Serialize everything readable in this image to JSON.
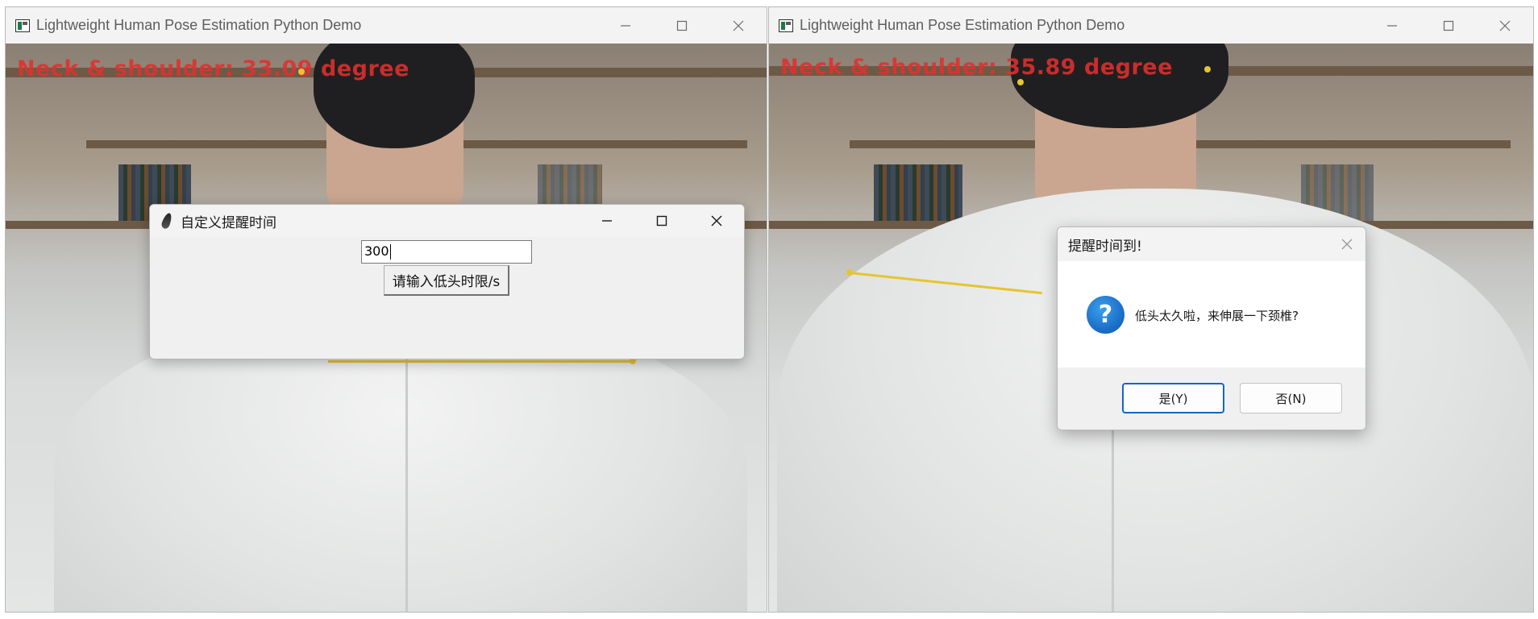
{
  "left_window": {
    "title": "Lightweight Human Pose Estimation Python Demo",
    "overlay_text": "Neck & shoulder: 33.09 degree"
  },
  "right_window": {
    "title": "Lightweight Human Pose Estimation Python Demo",
    "overlay_text": "Neck & shoulder: 35.89 degree"
  },
  "tk_dialog": {
    "title": "自定义提醒时间",
    "entry_value": "300",
    "button_label": "请输入低头时限/s"
  },
  "message_box": {
    "title": "提醒时间到!",
    "message": "低头太久啦，来伸展一下颈椎?",
    "icon_glyph": "?",
    "yes_label": "是(Y)",
    "no_label": "否(N)"
  },
  "colors": {
    "overlay_text": "#e2302e",
    "keypoint": "#e5c531",
    "focus_accent": "#1166c4",
    "question_icon": "#1c70c9"
  },
  "icons": [
    "app-icon",
    "minimize-icon",
    "maximize-icon",
    "close-icon",
    "feather-icon",
    "question-icon"
  ]
}
